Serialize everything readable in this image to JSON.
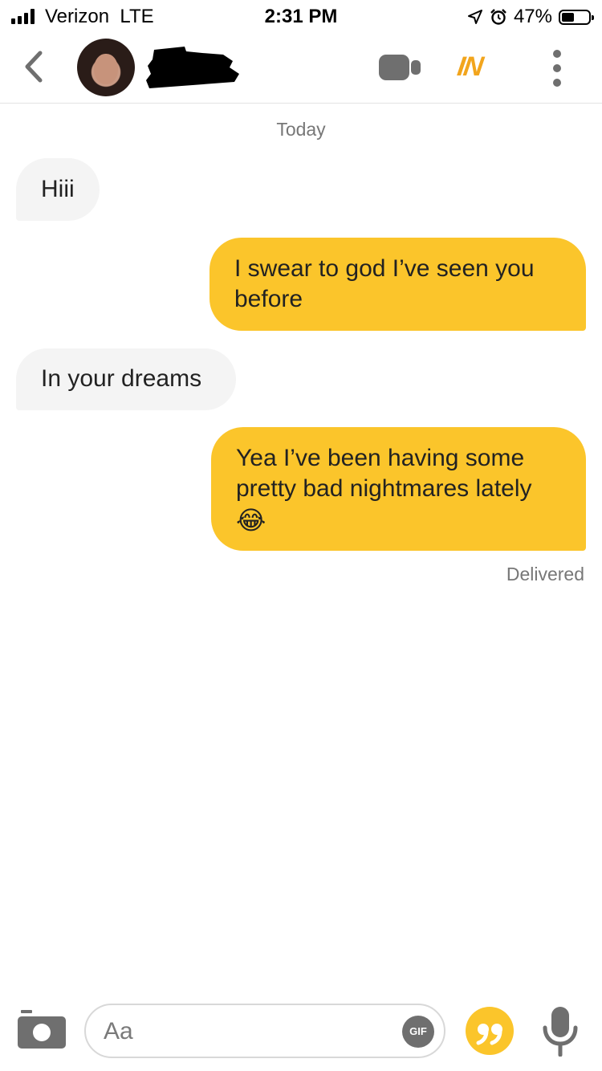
{
  "status_bar": {
    "carrier": "Verizon",
    "network": "LTE",
    "time": "2:31 PM",
    "battery_percent": "47%",
    "battery_level": 0.47,
    "icons": [
      "signal-icon",
      "location-icon",
      "alarm-icon",
      "battery-icon"
    ]
  },
  "header": {
    "back_icon": "chevron-left-icon",
    "avatar": "profile-photo",
    "name_redacted": true,
    "video_icon": "video-camera-icon",
    "logo_text": "IN",
    "more_icon": "more-vertical-icon"
  },
  "chat": {
    "date_label": "Today",
    "messages": [
      {
        "direction": "incoming",
        "text": "Hiii"
      },
      {
        "direction": "outgoing",
        "text": "I swear to god I’ve seen you before"
      },
      {
        "direction": "incoming",
        "text": "In your dreams"
      },
      {
        "direction": "outgoing",
        "text": "Yea I’ve been having some pretty bad nightmares lately",
        "emoji": "😂"
      }
    ],
    "receipt": "Delivered"
  },
  "composer": {
    "camera_icon": "camera-icon",
    "placeholder": "Aa",
    "gif_label": "GIF",
    "quote_icon": "quote-icon",
    "mic_icon": "microphone-icon"
  },
  "colors": {
    "accent": "#fbc52b",
    "incoming_bubble": "#f4f4f4",
    "logo": "#f2a51d",
    "icon_gray": "#6f6f6f"
  }
}
